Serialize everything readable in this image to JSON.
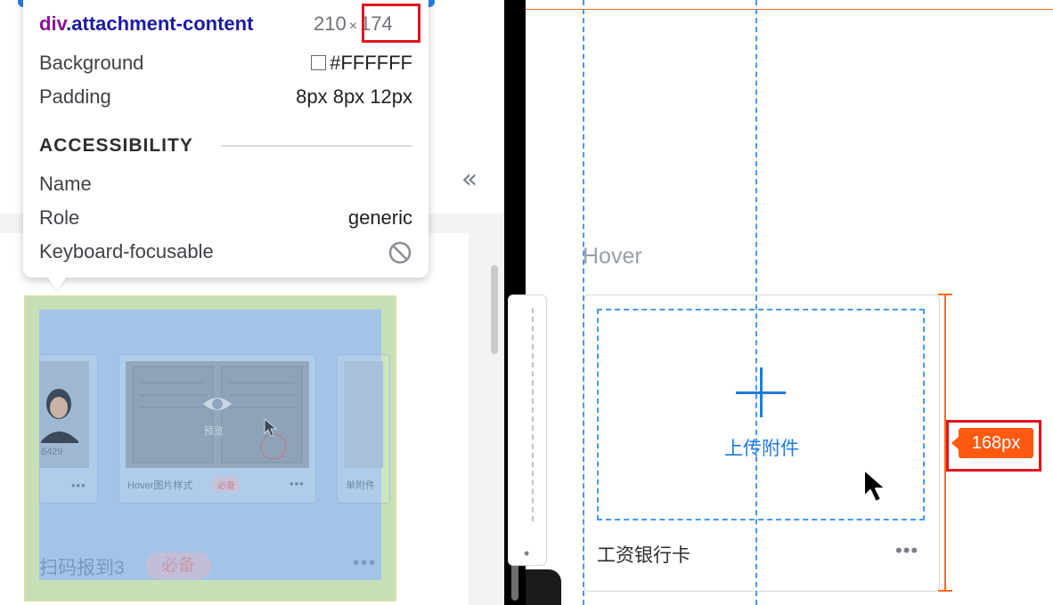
{
  "inspector": {
    "tag": "div",
    "class_name": ".attachment-content",
    "width": "210",
    "height": "174",
    "rows": {
      "background": {
        "label": "Background",
        "value": "#FFFFFF"
      },
      "padding": {
        "label": "Padding",
        "value": "8px 8px 12px"
      }
    },
    "accessibility": {
      "section_title": "ACCESSIBILITY",
      "name": {
        "label": "Name",
        "value": ""
      },
      "role": {
        "label": "Role",
        "value": "generic"
      },
      "focusable": {
        "label": "Keyboard-focusable"
      }
    }
  },
  "highlighted": {
    "mini_cards": [
      {
        "number": "6429",
        "dots": "•••"
      },
      {
        "overlay_text": "预览",
        "title": "Hover图片样式",
        "badge": "必备",
        "dots": "•••"
      },
      {
        "title": "单附件"
      }
    ],
    "label": "扫码报到3",
    "badge": "必备",
    "dots": "•••"
  },
  "right_panel": {
    "state_label": "Hover",
    "upload_label": "上传附件",
    "card_title": "工资银行卡",
    "card_dots": "•••",
    "prev_dots": "•",
    "measure": "168px"
  },
  "colors": {
    "accent_blue": "#1f7ae0",
    "measure_orange": "#ff5a0f",
    "highlight_red": "#e0141f"
  },
  "icons": {
    "collapse": "double-chevron-left-icon",
    "plus": "plus-icon",
    "cursor": "mouse-pointer-icon",
    "not_focusable": "no-entry-icon"
  }
}
